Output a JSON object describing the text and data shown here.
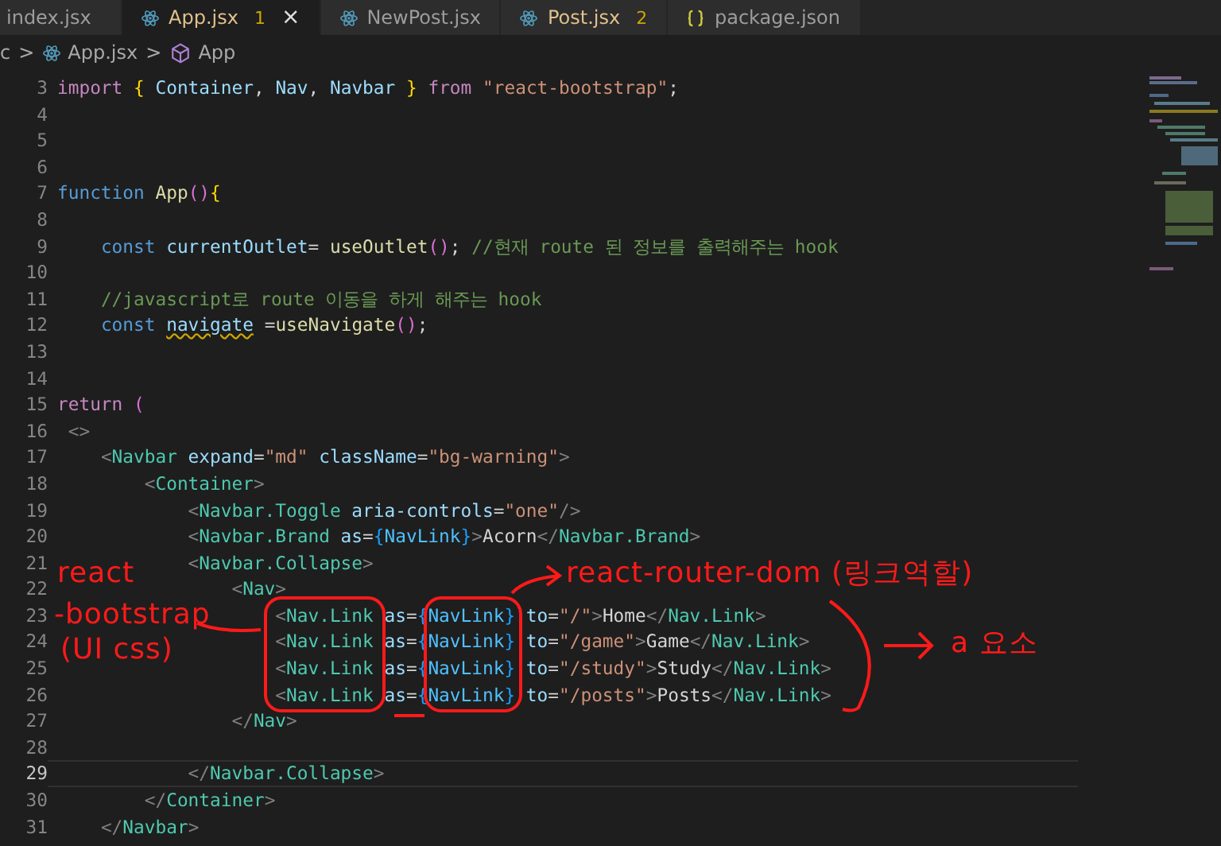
{
  "tabs": [
    {
      "label": "index.jsx",
      "kind": "plain",
      "selected": false,
      "modified": false
    },
    {
      "label": "App.jsx",
      "kind": "react",
      "selected": true,
      "modified": true,
      "badge": "1",
      "close": "×"
    },
    {
      "label": "NewPost.jsx",
      "kind": "react",
      "selected": false,
      "modified": false
    },
    {
      "label": "Post.jsx",
      "kind": "react",
      "selected": false,
      "modified": true,
      "badge": "2"
    },
    {
      "label": "package.json",
      "kind": "json",
      "selected": false,
      "modified": false
    }
  ],
  "breadcrumb": [
    {
      "label": "c",
      "kind": "folder"
    },
    {
      "label": "App.jsx",
      "kind": "react"
    },
    {
      "label": "App",
      "kind": "symbol"
    }
  ],
  "breadcrumb_separator": ">",
  "lines": [
    {
      "number": "3",
      "current": false,
      "tokens": [
        {
          "kind": "kw",
          "text": "import"
        },
        {
          "kind": "br",
          "text": " { "
        },
        {
          "kind": "var",
          "text": "Container"
        },
        {
          "kind": "p",
          "text": ", "
        },
        {
          "kind": "var",
          "text": "Nav"
        },
        {
          "kind": "p",
          "text": ", "
        },
        {
          "kind": "var",
          "text": "Navbar"
        },
        {
          "kind": "br",
          "text": " } "
        },
        {
          "kind": "kw",
          "text": "from "
        },
        {
          "kind": "str",
          "text": "\"react-bootstrap\""
        },
        {
          "kind": "p",
          "text": ";"
        }
      ]
    },
    {
      "number": "4",
      "current": false
    },
    {
      "number": "5",
      "current": false
    },
    {
      "number": "6",
      "current": false
    },
    {
      "number": "7",
      "current": false,
      "tokens": [
        {
          "kind": "st",
          "text": "function "
        },
        {
          "kind": "fn",
          "text": "App"
        },
        {
          "kind": "pr",
          "text": "()"
        },
        {
          "kind": "br",
          "text": "{"
        }
      ]
    },
    {
      "number": "8",
      "current": false
    },
    {
      "number": "9",
      "current": false,
      "tokens": [
        {
          "kind": "st",
          "text": "    const "
        },
        {
          "kind": "var",
          "text": "currentOutlet"
        },
        {
          "kind": "p",
          "text": "= "
        },
        {
          "kind": "fn",
          "text": "useOutlet"
        },
        {
          "kind": "pr",
          "text": "()"
        },
        {
          "kind": "p",
          "text": "; "
        },
        {
          "kind": "cm",
          "text": "//현재 route 된 정보를 출력해주는 hook"
        }
      ]
    },
    {
      "number": "10",
      "current": false
    },
    {
      "number": "11",
      "current": false,
      "tokens": [
        {
          "kind": "cm",
          "text": "    //javascript로 route 이동을 하게 해주는 hook"
        }
      ]
    },
    {
      "number": "12",
      "current": false,
      "tokens": [
        {
          "kind": "st",
          "text": "    const "
        },
        {
          "kind": "var",
          "text": "navigate",
          "warning": true
        },
        {
          "kind": "p",
          "text": " ="
        },
        {
          "kind": "fn",
          "text": "useNavigate"
        },
        {
          "kind": "pr",
          "text": "()"
        },
        {
          "kind": "p",
          "text": ";"
        }
      ]
    },
    {
      "number": "13",
      "current": false
    },
    {
      "number": "14",
      "current": false
    },
    {
      "number": "15",
      "current": false,
      "tokens": [
        {
          "kind": "kw",
          "text": "return"
        },
        {
          "kind": "pr",
          "text": " ("
        }
      ]
    },
    {
      "number": "16",
      "current": false,
      "tokens": [
        {
          "kind": "pu",
          "text": " <>"
        }
      ]
    },
    {
      "number": "17",
      "current": false,
      "tokens": [
        {
          "kind": "pu",
          "text": "    <"
        },
        {
          "kind": "tag",
          "text": "Navbar"
        },
        {
          "kind": "var",
          "text": " expand"
        },
        {
          "kind": "p",
          "text": "="
        },
        {
          "kind": "str",
          "text": "\"md\""
        },
        {
          "kind": "var",
          "text": " className"
        },
        {
          "kind": "p",
          "text": "="
        },
        {
          "kind": "str",
          "text": "\"bg-warning\""
        },
        {
          "kind": "pu",
          "text": ">"
        }
      ]
    },
    {
      "number": "18",
      "current": false,
      "tokens": [
        {
          "kind": "pu",
          "text": "        <"
        },
        {
          "kind": "tag",
          "text": "Container"
        },
        {
          "kind": "pu",
          "text": ">"
        }
      ]
    },
    {
      "number": "19",
      "current": false,
      "tokens": [
        {
          "kind": "pu",
          "text": "            <"
        },
        {
          "kind": "tag",
          "text": "Navbar.Toggle"
        },
        {
          "kind": "var",
          "text": " aria-controls"
        },
        {
          "kind": "p",
          "text": "="
        },
        {
          "kind": "str",
          "text": "\"one\""
        },
        {
          "kind": "pu",
          "text": "/>"
        }
      ]
    },
    {
      "number": "20",
      "current": false,
      "tokens": [
        {
          "kind": "pu",
          "text": "            <"
        },
        {
          "kind": "tag",
          "text": "Navbar.Brand"
        },
        {
          "kind": "var",
          "text": " as"
        },
        {
          "kind": "p",
          "text": "="
        },
        {
          "kind": "jb",
          "text": "{"
        },
        {
          "kind": "ref",
          "text": "NavLink"
        },
        {
          "kind": "jb",
          "text": "}"
        },
        {
          "kind": "pu",
          "text": ">"
        },
        {
          "kind": "p",
          "text": "Acorn"
        },
        {
          "kind": "pu",
          "text": "</"
        },
        {
          "kind": "tag",
          "text": "Navbar.Brand"
        },
        {
          "kind": "pu",
          "text": ">"
        }
      ]
    },
    {
      "number": "21",
      "current": false,
      "tokens": [
        {
          "kind": "pu",
          "text": "            <"
        },
        {
          "kind": "tag",
          "text": "Navbar.Collapse"
        },
        {
          "kind": "pu",
          "text": ">"
        }
      ]
    },
    {
      "number": "22",
      "current": false,
      "tokens": [
        {
          "kind": "pu",
          "text": "                <"
        },
        {
          "kind": "tag",
          "text": "Nav"
        },
        {
          "kind": "pu",
          "text": ">"
        }
      ]
    },
    {
      "number": "23",
      "current": false,
      "tokens": [
        {
          "kind": "pu",
          "text": "                    <"
        },
        {
          "kind": "tag",
          "text": "Nav.Link"
        },
        {
          "kind": "var",
          "text": " as"
        },
        {
          "kind": "p",
          "text": "="
        },
        {
          "kind": "jb",
          "text": "{"
        },
        {
          "kind": "ref",
          "text": "NavLink"
        },
        {
          "kind": "jb",
          "text": "}"
        },
        {
          "kind": "var",
          "text": " to"
        },
        {
          "kind": "p",
          "text": "="
        },
        {
          "kind": "str",
          "text": "\"/\""
        },
        {
          "kind": "pu",
          "text": ">"
        },
        {
          "kind": "p",
          "text": "Home"
        },
        {
          "kind": "pu",
          "text": "</"
        },
        {
          "kind": "tag",
          "text": "Nav.Link"
        },
        {
          "kind": "pu",
          "text": ">"
        }
      ]
    },
    {
      "number": "24",
      "current": false,
      "tokens": [
        {
          "kind": "pu",
          "text": "                    <"
        },
        {
          "kind": "tag",
          "text": "Nav.Link"
        },
        {
          "kind": "var",
          "text": " as"
        },
        {
          "kind": "p",
          "text": "="
        },
        {
          "kind": "jb",
          "text": "{"
        },
        {
          "kind": "ref",
          "text": "NavLink"
        },
        {
          "kind": "jb",
          "text": "}"
        },
        {
          "kind": "var",
          "text": " to"
        },
        {
          "kind": "p",
          "text": "="
        },
        {
          "kind": "str",
          "text": "\"/game\""
        },
        {
          "kind": "pu",
          "text": ">"
        },
        {
          "kind": "p",
          "text": "Game"
        },
        {
          "kind": "pu",
          "text": "</"
        },
        {
          "kind": "tag",
          "text": "Nav.Link"
        },
        {
          "kind": "pu",
          "text": ">"
        }
      ]
    },
    {
      "number": "25",
      "current": false,
      "tokens": [
        {
          "kind": "pu",
          "text": "                    <"
        },
        {
          "kind": "tag",
          "text": "Nav.Link"
        },
        {
          "kind": "var",
          "text": " as"
        },
        {
          "kind": "p",
          "text": "="
        },
        {
          "kind": "jb",
          "text": "{"
        },
        {
          "kind": "ref",
          "text": "NavLink"
        },
        {
          "kind": "jb",
          "text": "}"
        },
        {
          "kind": "var",
          "text": " to"
        },
        {
          "kind": "p",
          "text": "="
        },
        {
          "kind": "str",
          "text": "\"/study\""
        },
        {
          "kind": "pu",
          "text": ">"
        },
        {
          "kind": "p",
          "text": "Study"
        },
        {
          "kind": "pu",
          "text": "</"
        },
        {
          "kind": "tag",
          "text": "Nav.Link"
        },
        {
          "kind": "pu",
          "text": ">"
        }
      ]
    },
    {
      "number": "26",
      "current": false,
      "tokens": [
        {
          "kind": "pu",
          "text": "                    <"
        },
        {
          "kind": "tag",
          "text": "Nav.Link"
        },
        {
          "kind": "var",
          "text": " as"
        },
        {
          "kind": "p",
          "text": "="
        },
        {
          "kind": "jb",
          "text": "{"
        },
        {
          "kind": "ref",
          "text": "NavLink"
        },
        {
          "kind": "jb",
          "text": "}"
        },
        {
          "kind": "var",
          "text": " to"
        },
        {
          "kind": "p",
          "text": "="
        },
        {
          "kind": "str",
          "text": "\"/posts\""
        },
        {
          "kind": "pu",
          "text": ">"
        },
        {
          "kind": "p",
          "text": "Posts"
        },
        {
          "kind": "pu",
          "text": "</"
        },
        {
          "kind": "tag",
          "text": "Nav.Link"
        },
        {
          "kind": "pu",
          "text": ">"
        }
      ]
    },
    {
      "number": "27",
      "current": false,
      "tokens": [
        {
          "kind": "pu",
          "text": "                </"
        },
        {
          "kind": "tag",
          "text": "Nav"
        },
        {
          "kind": "pu",
          "text": ">"
        }
      ]
    },
    {
      "number": "28",
      "current": false
    },
    {
      "number": "29",
      "current": true,
      "tokens": [
        {
          "kind": "pu",
          "text": "            </"
        },
        {
          "kind": "tag",
          "text": "Navbar.Collapse"
        },
        {
          "kind": "pu",
          "text": ">"
        }
      ]
    },
    {
      "number": "30",
      "current": false,
      "tokens": [
        {
          "kind": "pu",
          "text": "        </"
        },
        {
          "kind": "tag",
          "text": "Container"
        },
        {
          "kind": "pu",
          "text": ">"
        }
      ]
    },
    {
      "number": "31",
      "current": false,
      "tokens": [
        {
          "kind": "pu",
          "text": "    </"
        },
        {
          "kind": "tag",
          "text": "Navbar"
        },
        {
          "kind": "pu",
          "text": ">"
        }
      ]
    }
  ],
  "annotations": [
    "react",
    "-bootstrap",
    "(UI css)",
    "react-router-dom (링크역할)",
    "a 요소"
  ]
}
